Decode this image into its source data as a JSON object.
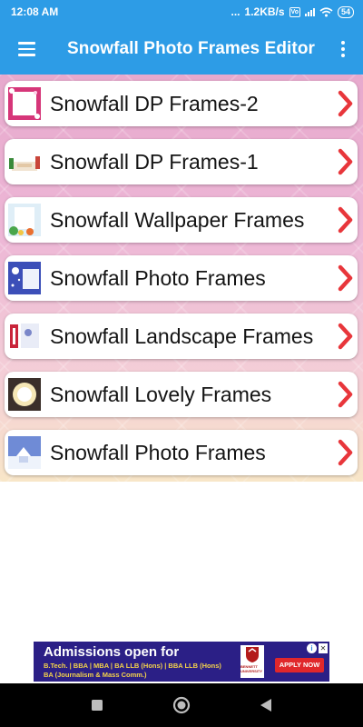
{
  "status_bar": {
    "time": "12:08 AM",
    "dots": "...",
    "net_speed": "1.2KB/s",
    "vo_badge": "Vo",
    "battery": "54"
  },
  "app_bar": {
    "title": "Snowfall Photo Frames Editor",
    "menu_icon": "hamburger-menu-icon",
    "more_icon": "more-vert-icon",
    "color": "#2d9ce6"
  },
  "list": {
    "items": [
      {
        "label": "Snowfall DP Frames-2"
      },
      {
        "label": "Snowfall DP Frames-1"
      },
      {
        "label": "Snowfall Wallpaper Frames"
      },
      {
        "label": "Snowfall Photo Frames"
      },
      {
        "label": "Snowfall Landscape Frames"
      },
      {
        "label": "Snowfall Lovely Frames"
      },
      {
        "label": "Snowfall Photo Frames"
      }
    ],
    "chevron_color": "#e8363b"
  },
  "ad": {
    "title": "Admissions open for",
    "line1": "B.Tech. | BBA | MBA | BA LLB (Hons) | BBA LLB (Hons)",
    "line2": "BA (Journalism & Mass Comm.)",
    "logo_text": "BENNETT UNIVERSITY",
    "apply": "APPLY NOW",
    "info": "i",
    "close": "✕"
  },
  "nav_bar": {
    "recent_icon": "square-recents-icon",
    "home_icon": "circle-home-icon",
    "back_icon": "triangle-back-icon"
  }
}
